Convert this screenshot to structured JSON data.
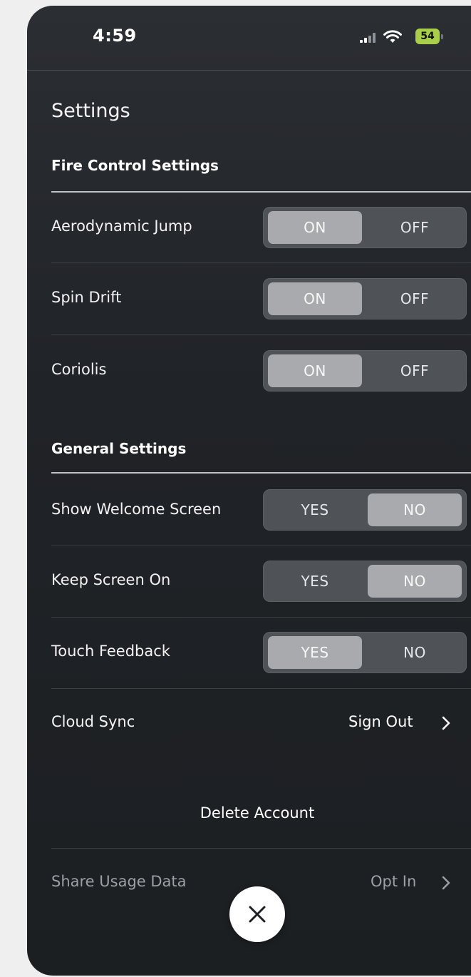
{
  "status_bar": {
    "time": "4:59",
    "battery_level": "54",
    "signal_icon": "cellular-signal-icon",
    "wifi_icon": "wifi-icon",
    "battery_color": "#a9cf4a"
  },
  "page": {
    "title": "Settings"
  },
  "fire_control": {
    "header": "Fire Control Settings",
    "rows": [
      {
        "label": "Aerodynamic Jump",
        "on_label": "ON",
        "off_label": "OFF",
        "selected": "ON"
      },
      {
        "label": "Spin Drift",
        "on_label": "ON",
        "off_label": "OFF",
        "selected": "ON"
      },
      {
        "label": "Coriolis",
        "on_label": "ON",
        "off_label": "OFF",
        "selected": "ON"
      }
    ]
  },
  "general": {
    "header": "General Settings",
    "rows": [
      {
        "label": "Show Welcome Screen",
        "yes_label": "YES",
        "no_label": "NO",
        "selected": "NO"
      },
      {
        "label": "Keep Screen On",
        "yes_label": "YES",
        "no_label": "NO",
        "selected": "NO"
      },
      {
        "label": "Touch Feedback",
        "yes_label": "YES",
        "no_label": "NO",
        "selected": "YES"
      }
    ]
  },
  "cloud_sync": {
    "label": "Cloud Sync",
    "action": "Sign Out"
  },
  "delete_account": {
    "label": "Delete Account"
  },
  "share_usage": {
    "label": "Share Usage Data",
    "action": "Opt In"
  },
  "close": {
    "icon": "close-icon"
  },
  "colors": {
    "segment_selected": "#a8aaae",
    "segment_track": "#4f5257",
    "background": "#202327"
  }
}
